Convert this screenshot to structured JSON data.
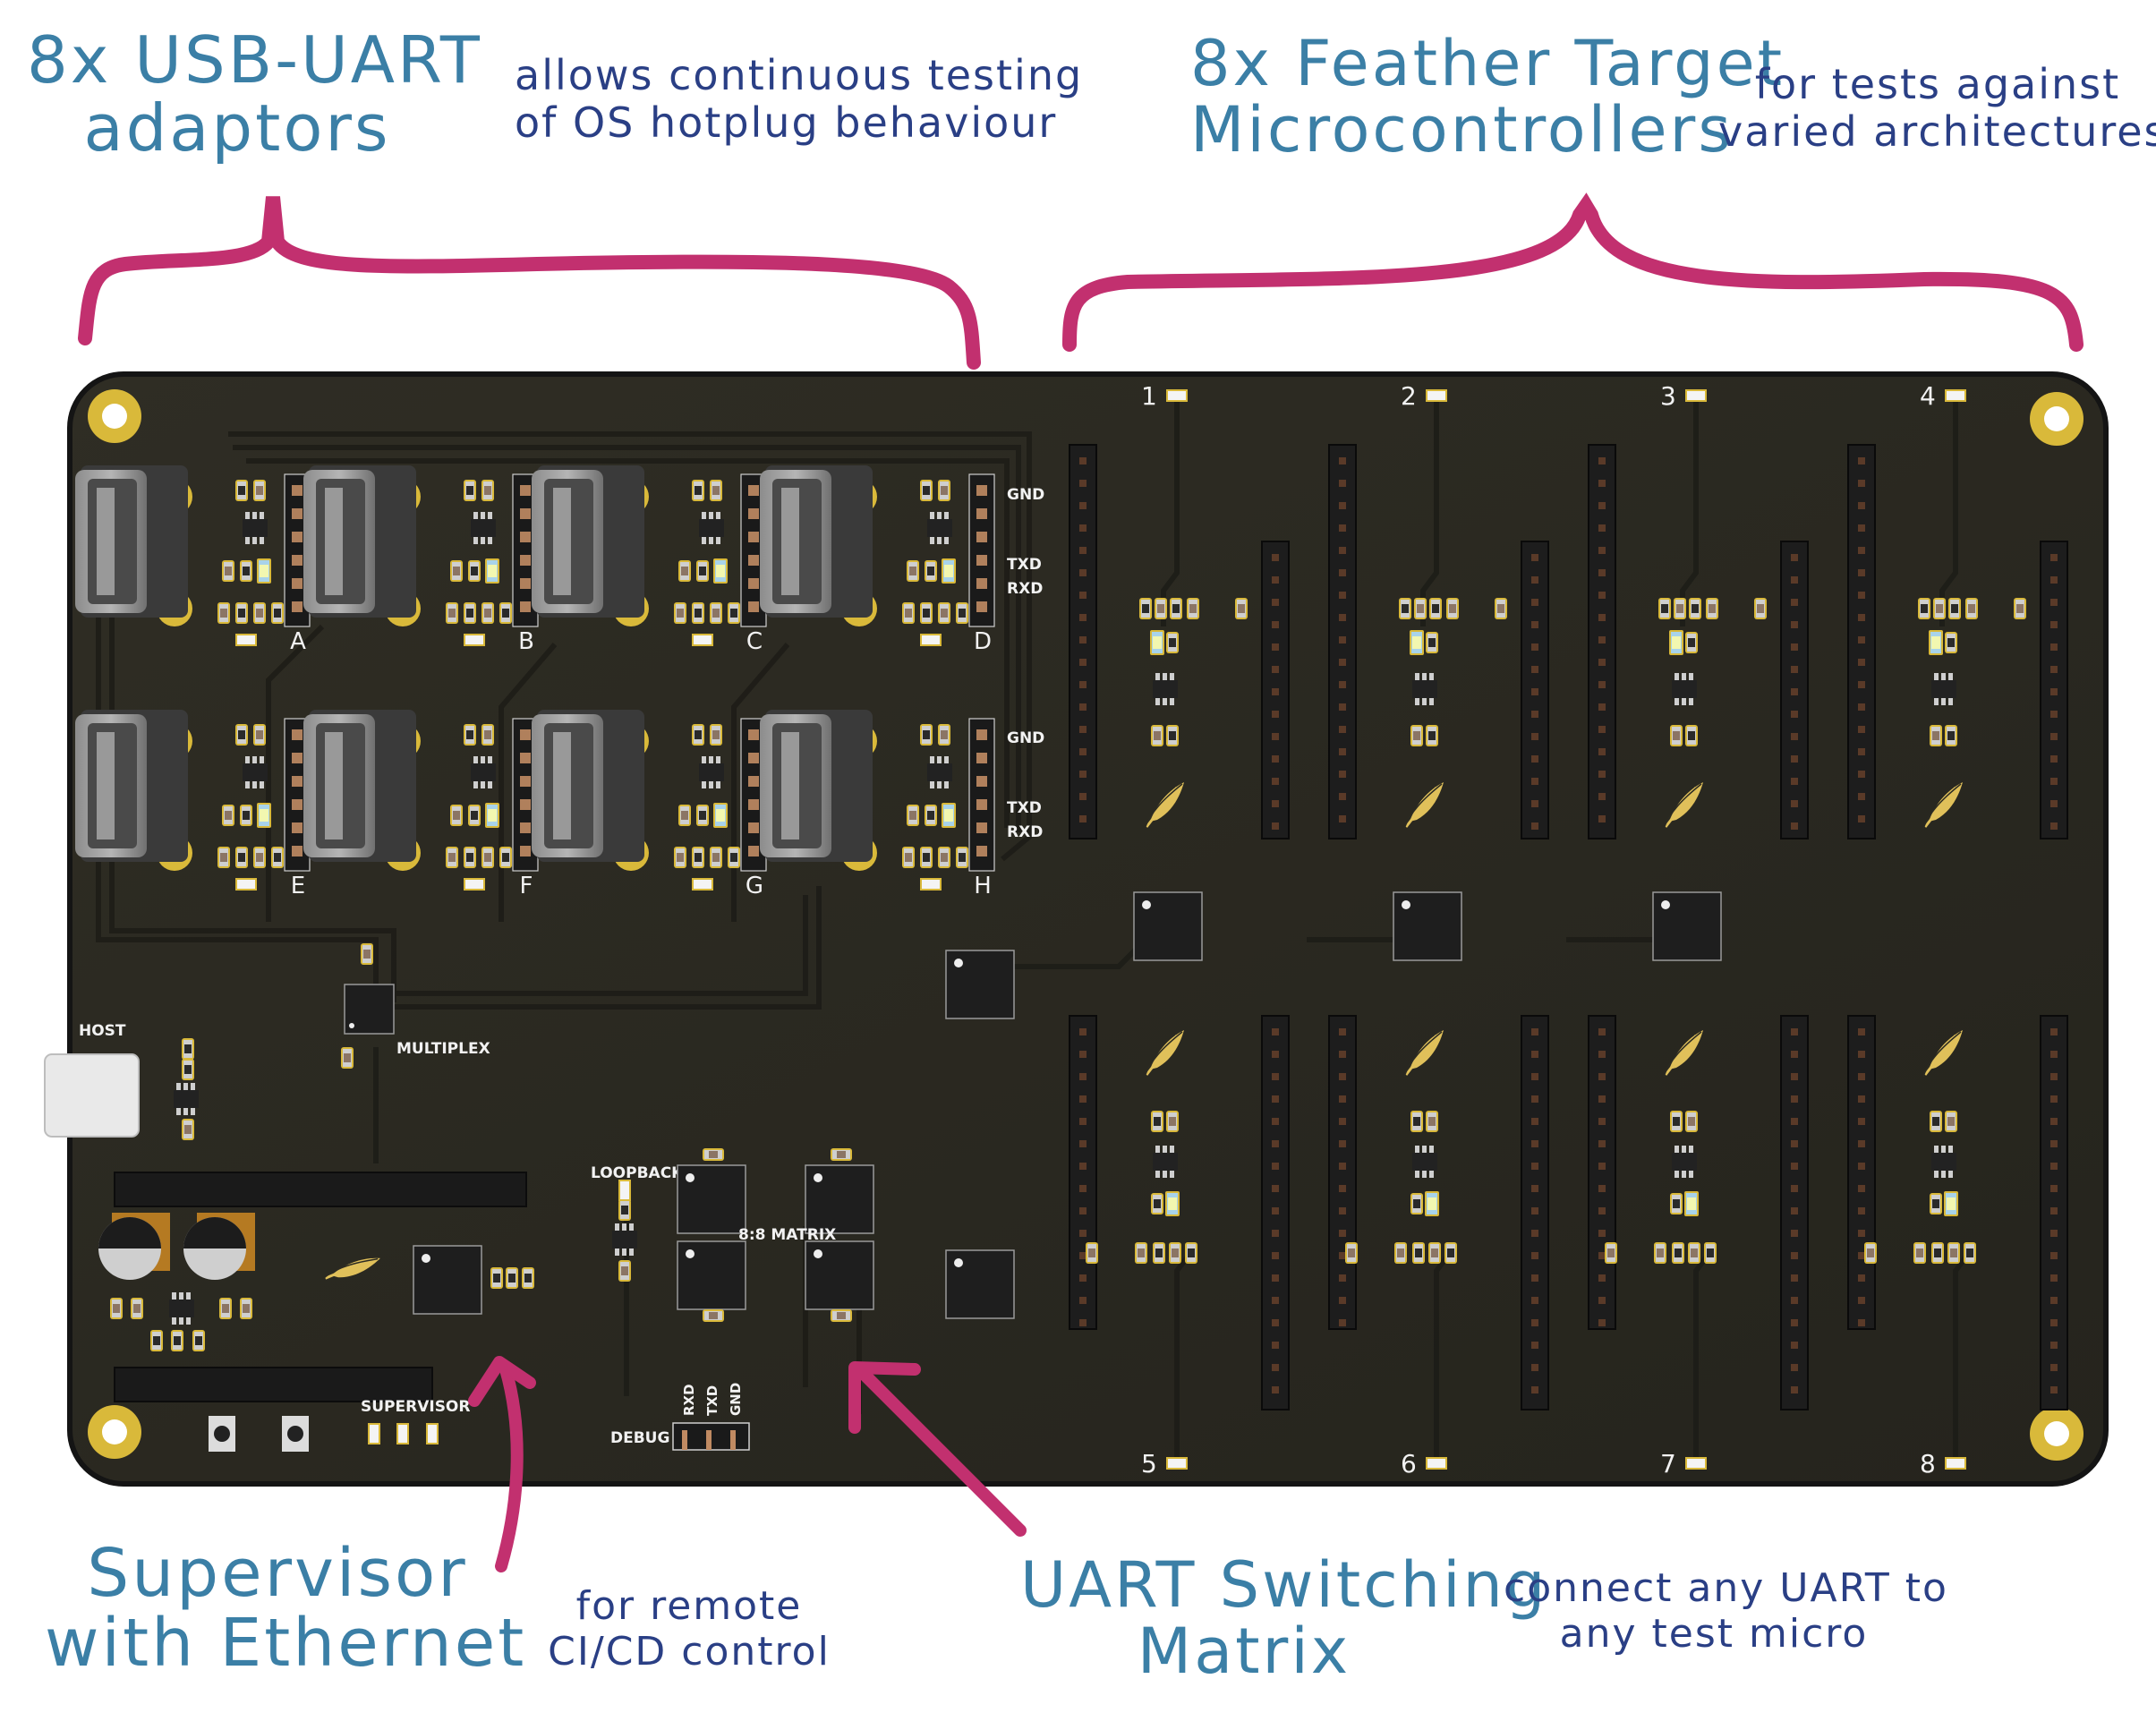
{
  "annotations": {
    "usb_uart": {
      "title_line1": "8x USB-UART",
      "title_line2": "adaptors",
      "note_line1": "allows continuous testing",
      "note_line2": "of OS hotplug behaviour"
    },
    "feather": {
      "title_line1": "8x Feather Target",
      "title_line2": "Microcontrollers",
      "note_line1": "for tests against",
      "note_line2": "varied architectures"
    },
    "supervisor": {
      "title_line1": "Supervisor",
      "title_line2": "with Ethernet",
      "note_line1": "for remote",
      "note_line2": "CI/CD control"
    },
    "matrix": {
      "title_line1": "UART Switching",
      "title_line2": "Matrix",
      "note_line1": "connect any UART to",
      "note_line2": "any test micro"
    }
  },
  "board": {
    "usb_ports": [
      "A",
      "B",
      "C",
      "D",
      "E",
      "F",
      "G",
      "H"
    ],
    "uart_header_pins": {
      "gnd": "GND",
      "txd": "TXD",
      "rxd": "RXD"
    },
    "target_slots": [
      "1",
      "2",
      "3",
      "4",
      "5",
      "6",
      "7",
      "8"
    ],
    "labels": {
      "host": "HOST",
      "multiplex": "MULTIPLEX",
      "loopback": "LOOPBACK",
      "matrix": "8:8 MATRIX",
      "supervisor": "SUPERVISOR",
      "debug": "DEBUG",
      "debug_pins": [
        "RXD",
        "TXD",
        "GND"
      ]
    }
  },
  "colors": {
    "accent_brace": "#c2306f",
    "title_blue": "#3b7fa6",
    "note_navy": "#2a3f85",
    "pcb": "#2b2a22",
    "gold": "#d9b93a"
  }
}
